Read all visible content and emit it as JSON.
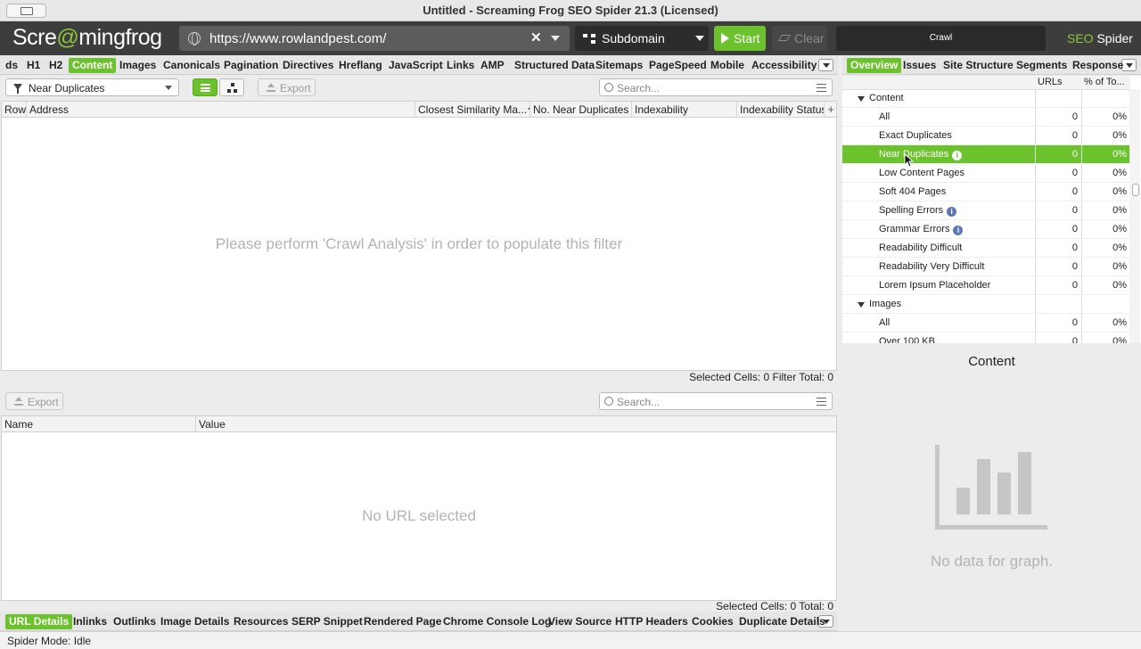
{
  "window": {
    "title": "Untitled - Screaming Frog SEO Spider 21.3 (Licensed)"
  },
  "toolbar": {
    "logo_pre": "Scre",
    "logo_frog": "@",
    "logo_post": "mingfrog",
    "url": "https://www.rowlandpest.com/",
    "scope": "Subdomain",
    "start_label": "Start",
    "clear_label": "Clear",
    "crawl_label": "Crawl",
    "brand_seo": "SEO",
    "brand_rest": " Spider"
  },
  "main_tabs": [
    {
      "label": "ds"
    },
    {
      "label": "H1"
    },
    {
      "label": "H2"
    },
    {
      "label": "Content",
      "active": true
    },
    {
      "label": "Images"
    },
    {
      "label": "Canonicals"
    },
    {
      "label": "Pagination"
    },
    {
      "label": "Directives"
    },
    {
      "label": "Hreflang"
    },
    {
      "label": "JavaScript"
    },
    {
      "label": "Links"
    },
    {
      "label": "AMP"
    },
    {
      "label": "Structured Data"
    },
    {
      "label": "Sitemaps"
    },
    {
      "label": "PageSpeed"
    },
    {
      "label": "Mobile"
    },
    {
      "label": "Accessibility"
    }
  ],
  "filter": {
    "selected": "Near Duplicates",
    "export_label": "Export",
    "search_placeholder": "Search..."
  },
  "main_table": {
    "columns": [
      "Row",
      "Address",
      "Closest Similarity Ma...",
      "No. Near Duplicates",
      "Indexability",
      "Indexability Status"
    ],
    "empty_message": "Please perform 'Crawl Analysis' in order to populate this filter",
    "status": "Selected Cells:  0  Filter Total:  0"
  },
  "details": {
    "export_label": "Export",
    "search_placeholder": "Search...",
    "columns": [
      "Name",
      "Value"
    ],
    "empty_message": "No URL selected",
    "status": "Selected Cells:  0  Total:  0"
  },
  "bottom_tabs": [
    {
      "label": "URL Details",
      "active": true
    },
    {
      "label": "Inlinks"
    },
    {
      "label": "Outlinks"
    },
    {
      "label": "Image Details"
    },
    {
      "label": "Resources"
    },
    {
      "label": "SERP Snippet"
    },
    {
      "label": "Rendered Page"
    },
    {
      "label": "Chrome Console Log"
    },
    {
      "label": "View Source"
    },
    {
      "label": "HTTP Headers"
    },
    {
      "label": "Cookies"
    },
    {
      "label": "Duplicate Details"
    }
  ],
  "right_tabs": [
    {
      "label": "Overview",
      "active": true
    },
    {
      "label": "Issues"
    },
    {
      "label": "Site Structure"
    },
    {
      "label": "Segments"
    },
    {
      "label": "Response"
    }
  ],
  "overview": {
    "col_urls": "URLs",
    "col_pct": "% of To...",
    "rows": [
      {
        "name": "Content",
        "group": true,
        "urls": "",
        "pct": ""
      },
      {
        "name": "All",
        "urls": "0",
        "pct": "0%"
      },
      {
        "name": "Exact Duplicates",
        "urls": "0",
        "pct": "0%"
      },
      {
        "name": "Near Duplicates",
        "urls": "0",
        "pct": "0%",
        "selected": true,
        "info": true
      },
      {
        "name": "Low Content Pages",
        "urls": "0",
        "pct": "0%"
      },
      {
        "name": "Soft 404 Pages",
        "urls": "0",
        "pct": "0%"
      },
      {
        "name": "Spelling Errors",
        "urls": "0",
        "pct": "0%",
        "info": true
      },
      {
        "name": "Grammar Errors",
        "urls": "0",
        "pct": "0%",
        "info": true
      },
      {
        "name": "Readability Difficult",
        "urls": "0",
        "pct": "0%"
      },
      {
        "name": "Readability Very Difficult",
        "urls": "0",
        "pct": "0%"
      },
      {
        "name": "Lorem Ipsum Placeholder",
        "urls": "0",
        "pct": "0%"
      },
      {
        "name": "Images",
        "group": true,
        "urls": "",
        "pct": ""
      },
      {
        "name": "All",
        "urls": "0",
        "pct": "0%"
      },
      {
        "name": "Over 100 KB",
        "urls": "0",
        "pct": "0%"
      }
    ]
  },
  "chart": {
    "title": "Content",
    "empty_message": "No data for graph."
  },
  "statusbar": {
    "mode": "Spider Mode: Idle"
  },
  "colors": {
    "accent": "#6cc22c",
    "toolbar": "#3d3d3d"
  }
}
